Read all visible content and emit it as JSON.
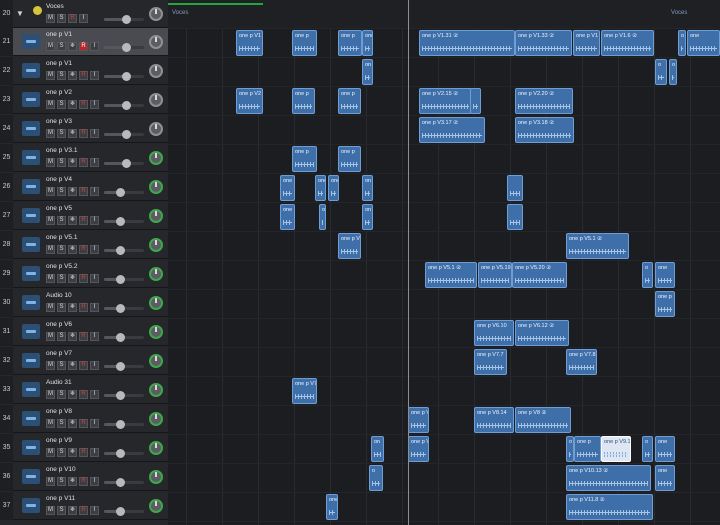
{
  "folder": {
    "number": "20",
    "name": "Voces",
    "region_label": "Voces",
    "region_label_right": "Voces"
  },
  "button_labels": {
    "mute": "M",
    "solo": "S",
    "freeze": "❄",
    "record": "R",
    "input": "I"
  },
  "tracks": [
    {
      "number": "21",
      "name": "one p V1",
      "selected": true,
      "record_armed": true,
      "level": 0.55
    },
    {
      "number": "22",
      "name": "one p V1",
      "selected": false,
      "record_armed": false,
      "level": 0.55
    },
    {
      "number": "23",
      "name": "one p V2",
      "selected": false,
      "record_armed": false,
      "level": 0.55
    },
    {
      "number": "24",
      "name": "one p V3",
      "selected": false,
      "record_armed": false,
      "level": 0.55
    },
    {
      "number": "25",
      "name": "one p V3.1",
      "selected": false,
      "record_armed": false,
      "level": 0.55
    },
    {
      "number": "26",
      "name": "one p V4",
      "selected": false,
      "record_armed": false,
      "level": 0.4
    },
    {
      "number": "27",
      "name": "one p V5",
      "selected": false,
      "record_armed": false,
      "level": 0.4
    },
    {
      "number": "28",
      "name": "one p V5.1",
      "selected": false,
      "record_armed": false,
      "level": 0.4
    },
    {
      "number": "29",
      "name": "one p V5.2",
      "selected": false,
      "record_armed": false,
      "level": 0.4
    },
    {
      "number": "30",
      "name": "Audio 10",
      "selected": false,
      "record_armed": false,
      "level": 0.4
    },
    {
      "number": "31",
      "name": "one p V6",
      "selected": false,
      "record_armed": false,
      "level": 0.4
    },
    {
      "number": "32",
      "name": "one p V7",
      "selected": false,
      "record_armed": false,
      "level": 0.4
    },
    {
      "number": "33",
      "name": "Audio 31",
      "selected": false,
      "record_armed": false,
      "level": 0.4
    },
    {
      "number": "34",
      "name": "one p V8",
      "selected": false,
      "record_armed": false,
      "level": 0.4
    },
    {
      "number": "35",
      "name": "one p V9",
      "selected": false,
      "record_armed": false,
      "level": 0.4
    },
    {
      "number": "36",
      "name": "one p V10",
      "selected": false,
      "record_armed": false,
      "level": 0.4
    },
    {
      "number": "37",
      "name": "one p V11",
      "selected": false,
      "record_armed": false,
      "level": 0.4
    }
  ],
  "regions": [
    {
      "track": 0,
      "label": "one p V1"
    },
    {
      "track": 0,
      "label": "one p"
    },
    {
      "track": 0,
      "label": "one p"
    },
    {
      "track": 0,
      "label": "one"
    },
    {
      "track": 0,
      "label": "one p V1.31 ②"
    },
    {
      "track": 0,
      "label": "one p V1.33 ②"
    },
    {
      "track": 0,
      "label": "one p V1"
    },
    {
      "track": 0,
      "label": "one p V1.6 ②"
    },
    {
      "track": 0,
      "label": "o"
    },
    {
      "track": 0,
      "label": "one"
    },
    {
      "track": 1,
      "label": "on"
    },
    {
      "track": 1,
      "label": "o"
    },
    {
      "track": 1,
      "label": "o"
    },
    {
      "track": 2,
      "label": "one p V2"
    },
    {
      "track": 2,
      "label": "one p"
    },
    {
      "track": 2,
      "label": "one p"
    },
    {
      "track": 2,
      "label": "one p V2.15 ②"
    },
    {
      "track": 2,
      "label": ""
    },
    {
      "track": 2,
      "label": "one p V2.20 ②"
    },
    {
      "track": 3,
      "label": "one p V3.17 ②"
    },
    {
      "track": 3,
      "label": "one p V3.18 ②"
    },
    {
      "track": 4,
      "label": "one p"
    },
    {
      "track": 4,
      "label": "one p"
    },
    {
      "track": 5,
      "label": "one"
    },
    {
      "track": 5,
      "label": "one"
    },
    {
      "track": 5,
      "label": "one"
    },
    {
      "track": 5,
      "label": "on"
    },
    {
      "track": 5,
      "label": ""
    },
    {
      "track": 6,
      "label": "one"
    },
    {
      "track": 6,
      "label": "one"
    },
    {
      "track": 6,
      "label": "on"
    },
    {
      "track": 6,
      "label": ""
    },
    {
      "track": 7,
      "label": "one p V"
    },
    {
      "track": 7,
      "label": "one p V5.1 ②"
    },
    {
      "track": 8,
      "label": "one p V5.1 ②"
    },
    {
      "track": 8,
      "label": "one p V5.19"
    },
    {
      "track": 8,
      "label": "one p V5.20 ②"
    },
    {
      "track": 8,
      "label": "o"
    },
    {
      "track": 8,
      "label": "one"
    },
    {
      "track": 9,
      "label": "one p"
    },
    {
      "track": 10,
      "label": "one p V6.10"
    },
    {
      "track": 10,
      "label": "one p V6.12 ②"
    },
    {
      "track": 11,
      "label": "one p V7.7"
    },
    {
      "track": 11,
      "label": "one p V7.8"
    },
    {
      "track": 12,
      "label": "one p V7"
    },
    {
      "track": 13,
      "label": "one p V"
    },
    {
      "track": 13,
      "label": "one p V8.14"
    },
    {
      "track": 13,
      "label": "one p V8 ②"
    },
    {
      "track": 14,
      "label": "on"
    },
    {
      "track": 14,
      "label": "one p V"
    },
    {
      "track": 14,
      "label": "o"
    },
    {
      "track": 14,
      "label": "one p"
    },
    {
      "track": 14,
      "label": "one p V9.19"
    },
    {
      "track": 14,
      "label": "o"
    },
    {
      "track": 14,
      "label": "one"
    },
    {
      "track": 15,
      "label": "o"
    },
    {
      "track": 15,
      "label": "one p V10.13 ②"
    },
    {
      "track": 15,
      "label": "one"
    },
    {
      "track": 16,
      "label": "one"
    },
    {
      "track": 16,
      "label": "one p V11.8 ②"
    }
  ]
}
